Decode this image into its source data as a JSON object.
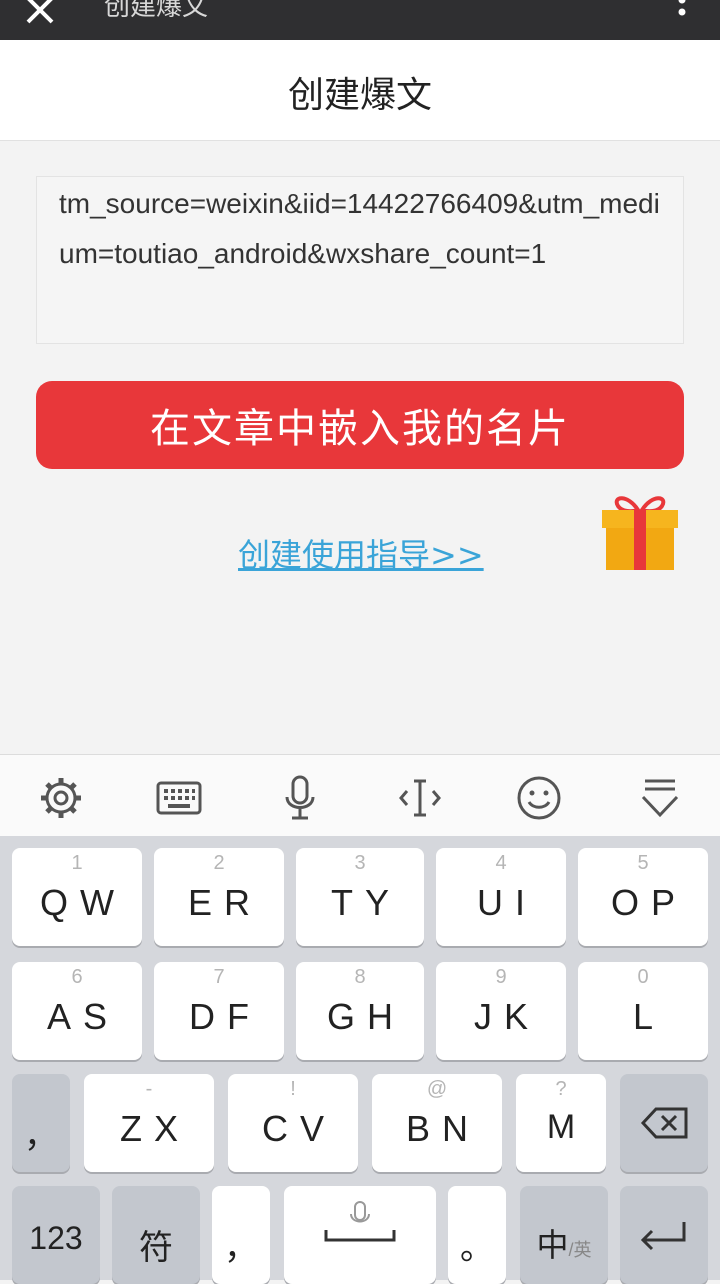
{
  "appbar": {
    "title": "创建爆文",
    "close_icon": "close-icon",
    "more_icon": "more-vertical-icon"
  },
  "page": {
    "title": "创建爆文"
  },
  "url_field": {
    "value": "tm_source=weixin&iid=14422766409&utm_medium=toutiao_android&wxshare_count=1"
  },
  "embed_button": {
    "label": "在文章中嵌入我的名片",
    "color": "#e8373a"
  },
  "guide_link": {
    "label": "创建使用指导>>",
    "color": "#3aa4d8"
  },
  "gift_icon": "gift-icon",
  "keyboard_toolbar": {
    "icons": [
      "gear-icon",
      "keyboard-icon",
      "microphone-icon",
      "cursor-icon",
      "smiley-icon",
      "collapse-keyboard-icon"
    ]
  },
  "keyboard": {
    "row1": [
      {
        "hint": "1",
        "label": "QW"
      },
      {
        "hint": "2",
        "label": "ER"
      },
      {
        "hint": "3",
        "label": "TY"
      },
      {
        "hint": "4",
        "label": "UI"
      },
      {
        "hint": "5",
        "label": "OP"
      }
    ],
    "row2": [
      {
        "hint": "6",
        "label": "AS"
      },
      {
        "hint": "7",
        "label": "DF"
      },
      {
        "hint": "8",
        "label": "GH"
      },
      {
        "hint": "9",
        "label": "JK"
      },
      {
        "hint": "0",
        "label": "L"
      }
    ],
    "row3": [
      {
        "hint": "",
        "label": "，"
      },
      {
        "hint": "-",
        "label": "ZX"
      },
      {
        "hint": "!",
        "label": "CV"
      },
      {
        "hint": "@",
        "label": "BN"
      },
      {
        "hint": "?",
        "label": "M"
      }
    ],
    "row4": {
      "num": "123",
      "symbol": "符",
      "comma": "，",
      "period": "。",
      "lang": "中",
      "lang_sub": "/英"
    }
  }
}
